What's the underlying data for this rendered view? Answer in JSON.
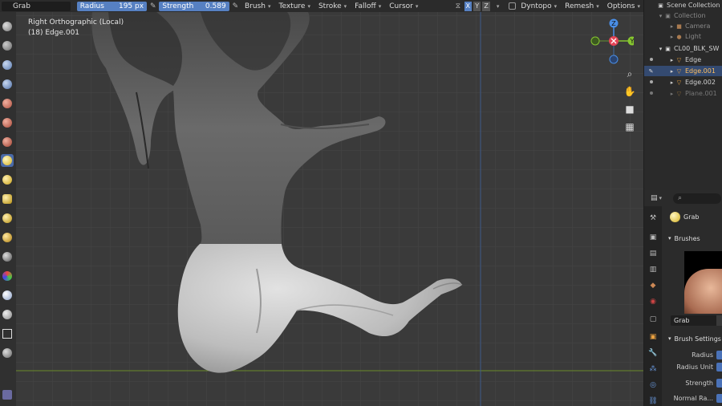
{
  "header": {
    "tool_name": "Grab",
    "radius_label": "Radius",
    "radius_value": "195 px",
    "strength_label": "Strength",
    "strength_value": "0.589",
    "menus": [
      "Brush",
      "Texture",
      "Stroke",
      "Falloff",
      "Cursor"
    ],
    "axes": [
      "X",
      "Y",
      "Z"
    ],
    "dyntopo_label": "Dyntopo",
    "remesh_label": "Remesh",
    "options_label": "Options"
  },
  "viewport": {
    "view_name": "Right Orthographic (Local)",
    "object_info": "(18) Edge.001",
    "gizmo_labels": {
      "z": "Z",
      "y": "Y"
    }
  },
  "outliner": {
    "scene_collection": "Scene Collection",
    "collection": "Collection",
    "camera": "Camera",
    "light": "Light",
    "group": "CL00_BLK_SW",
    "items": [
      "Edge",
      "Edge.001",
      "Edge.002",
      "Plane.001"
    ]
  },
  "properties": {
    "brush_name": "Grab",
    "brushes_section": "Brushes",
    "brush_field": "Grab",
    "brush_settings_section": "Brush Settings",
    "rows": [
      "Radius",
      "Radius Unit",
      "Strength",
      "Normal Ra..."
    ]
  },
  "colors": {
    "accent": "#5680c2",
    "x_axis": "#e44456",
    "y_axis": "#86c530",
    "z_axis": "#4a8ee6"
  }
}
